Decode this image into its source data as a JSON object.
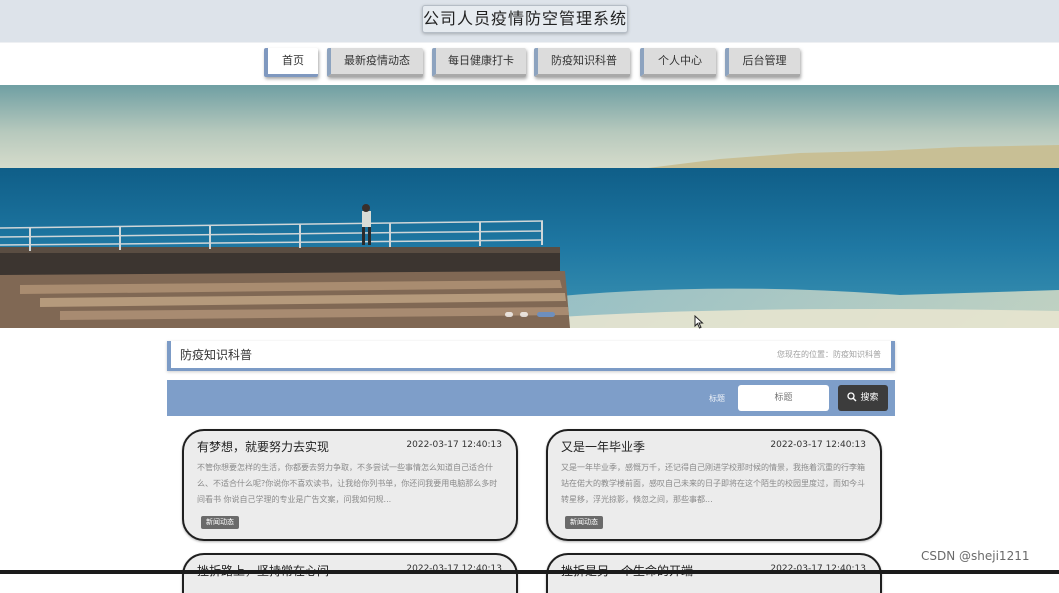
{
  "header": {
    "title": "公司人员疫情防空管理系统"
  },
  "nav": {
    "items": [
      {
        "label": "首页",
        "active": true
      },
      {
        "label": "最新疫情动态",
        "active": false
      },
      {
        "label": "每日健康打卡",
        "active": false
      },
      {
        "label": "防疫知识科普",
        "active": false
      },
      {
        "label": "个人中心",
        "active": false
      },
      {
        "label": "后台管理",
        "active": false
      }
    ]
  },
  "section": {
    "title": "防疫知识科普",
    "breadcrumb": "您现在的位置：防疫知识科普"
  },
  "search": {
    "label": "标题",
    "placeholder": "标题",
    "button_label": "搜索"
  },
  "articles": [
    {
      "title": "有梦想，就要努力去实现",
      "date": "2022-03-17 12:40:13",
      "excerpt": "不管你想要怎样的生活，你都要去努力争取，不多尝试一些事情怎么知道自己适合什么、不适合什么呢?你说你不喜欢读书，让我给你列书单，你还问我要用电脑那么多时间看书 你说自己学理的专业是广告文案，问我如何规...",
      "tag": "新闻动态"
    },
    {
      "title": "又是一年毕业季",
      "date": "2022-03-17 12:40:13",
      "excerpt": "又是一年毕业季，感慨万千，还记得自己刚进学校那时候的情景，我拖着沉重的行李箱站在偌大的教学楼前面，感叹自己未来的日子即将在这个陌生的校园里度过，而如今斗转星移，浮光掠影，倏忽之间，那些事都...",
      "tag": "新闻动态"
    },
    {
      "title": "挫折路上，坚持常在心间",
      "date": "2022-03-17 12:40:13"
    },
    {
      "title": "挫折是另一个生命的开端",
      "date": "2022-03-17 12:40:13"
    }
  ],
  "watermark": "CSDN @sheji1211",
  "colors": {
    "accent": "#7e9ec9",
    "header_bg": "#dde3ea",
    "button_dark": "#3c3c3c"
  }
}
